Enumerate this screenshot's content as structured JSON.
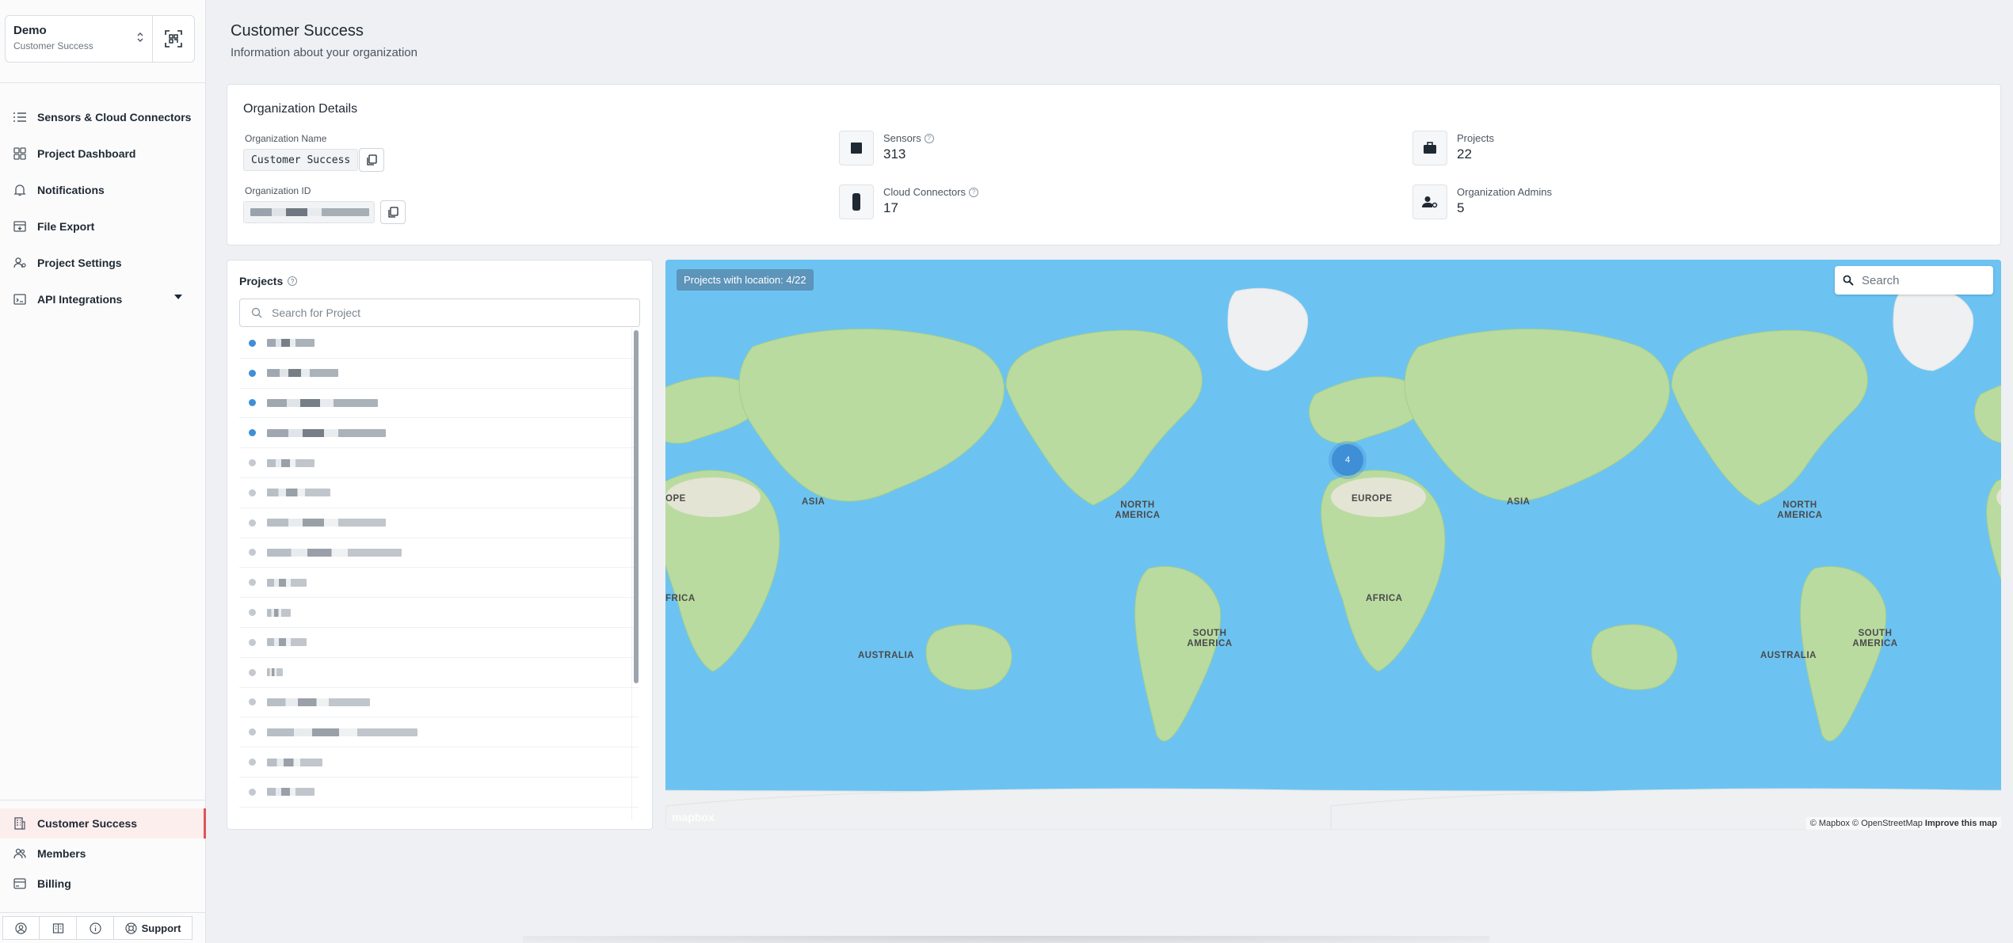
{
  "org_switcher": {
    "name": "Demo",
    "sub": "Customer Success"
  },
  "nav": {
    "items": [
      {
        "label": "Sensors & Cloud Connectors"
      },
      {
        "label": "Project Dashboard"
      },
      {
        "label": "Notifications"
      },
      {
        "label": "File Export"
      },
      {
        "label": "Project Settings"
      },
      {
        "label": "API Integrations"
      }
    ],
    "bottom": [
      {
        "label": "Customer Success"
      },
      {
        "label": "Members"
      },
      {
        "label": "Billing"
      }
    ],
    "support_label": "Support"
  },
  "header": {
    "title": "Customer Success",
    "subtitle": "Information about your organization"
  },
  "org_details": {
    "title": "Organization Details",
    "name_label": "Organization Name",
    "name_value": "Customer Success",
    "id_label": "Organization ID",
    "stats": [
      {
        "label": "Sensors",
        "value": "313",
        "icon": "sensor-icon"
      },
      {
        "label": "Cloud Connectors",
        "value": "17",
        "icon": "cloud-connector-icon"
      },
      {
        "label": "Projects",
        "value": "22",
        "icon": "briefcase-icon"
      },
      {
        "label": "Organization Admins",
        "value": "5",
        "icon": "admin-user-icon"
      }
    ]
  },
  "projects": {
    "title": "Projects",
    "search_placeholder": "Search for Project",
    "rows": [
      {
        "has_location": true
      },
      {
        "has_location": true
      },
      {
        "has_location": true
      },
      {
        "has_location": true
      },
      {
        "has_location": false
      },
      {
        "has_location": false
      },
      {
        "has_location": false
      },
      {
        "has_location": false
      },
      {
        "has_location": false
      },
      {
        "has_location": false
      },
      {
        "has_location": false
      },
      {
        "has_location": false
      },
      {
        "has_location": false
      },
      {
        "has_location": false
      },
      {
        "has_location": false
      },
      {
        "has_location": false
      }
    ]
  },
  "map": {
    "badge": "Projects with location: 4/22",
    "search_placeholder": "Search",
    "cluster_count": "4",
    "labels": [
      "ASIA",
      "NORTH AMERICA",
      "EUROPE",
      "ASIA",
      "NORTH AMERICA",
      "AFRICA",
      "SOUTH AMERICA",
      "AUSTRALIA",
      "AFRICA",
      "SOUTH AMERICA",
      "AUSTRALIA",
      "SOUTH AMERICA",
      "OPE",
      "FRICA"
    ],
    "logo": "mapbox",
    "attribution": "© Mapbox © OpenStreetMap",
    "improve": "Improve this map"
  }
}
